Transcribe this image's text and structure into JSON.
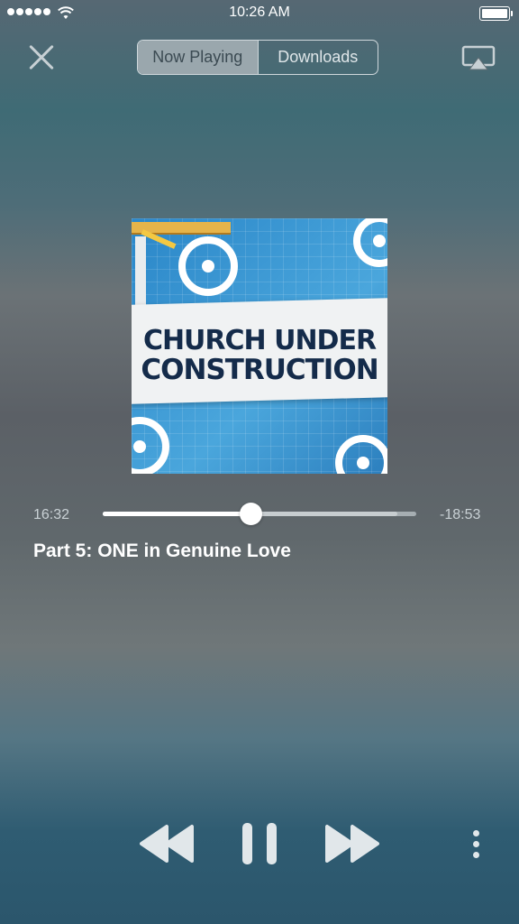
{
  "status_bar": {
    "time": "10:26 AM",
    "signal_icon": "signal-dots-icon",
    "wifi_icon": "wifi-icon",
    "battery_icon": "battery-full-icon"
  },
  "header": {
    "close_icon": "close-icon",
    "tabs": [
      {
        "label": "Now Playing",
        "active": true
      },
      {
        "label": "Downloads",
        "active": false
      }
    ],
    "airplay_icon": "airplay-icon"
  },
  "artwork": {
    "line1": "CHURCH UNDER",
    "line2": "CONSTRUCTION"
  },
  "player": {
    "elapsed": "16:32",
    "remaining": "-18:53",
    "progress_fraction": 0.47,
    "buffered_fraction": 0.94,
    "episode_title": "Part 5: ONE in Genuine Love"
  },
  "controls": {
    "rewind_icon": "rewind-icon",
    "pause_icon": "pause-icon",
    "fast_forward_icon": "fast-forward-icon",
    "more_icon": "more-vertical-icon"
  },
  "colors": {
    "accent": "#ffffff",
    "track": "#a6aeb2"
  }
}
